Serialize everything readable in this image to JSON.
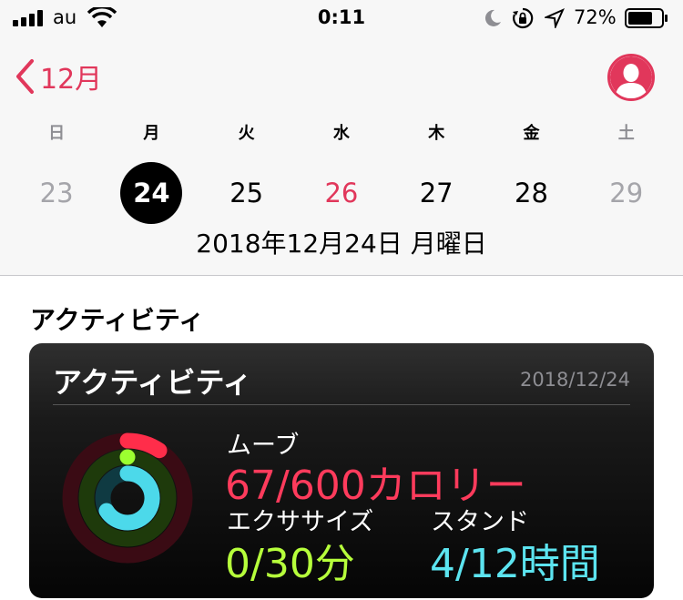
{
  "status_bar": {
    "carrier": "au",
    "time": "0:11",
    "battery_percent": "72%",
    "battery_level": 0.72
  },
  "nav": {
    "back_label": "12月"
  },
  "week": {
    "weekdays": [
      "日",
      "月",
      "火",
      "水",
      "木",
      "金",
      "土"
    ],
    "dates": [
      "23",
      "24",
      "25",
      "26",
      "27",
      "28",
      "29"
    ],
    "selected_index": 1,
    "highlighted_index": 3,
    "full_date": "2018年12月24日 月曜日"
  },
  "section": {
    "title": "アクティビティ"
  },
  "card": {
    "title": "アクティビティ",
    "date": "2018/12/24",
    "move_label": "ムーブ",
    "move_value": "67/600カロリー",
    "exercise_label": "エクササイズ",
    "exercise_value": "0/30分",
    "stand_label": "スタンド",
    "stand_value": "4/12時間"
  },
  "colors": {
    "accent": "#e1375b",
    "move": "#ff3b5c",
    "exercise": "#b6ff3b",
    "stand": "#5ce4f0"
  },
  "icons": [
    "cellular-signal-icon",
    "wifi-icon",
    "moon-icon",
    "rotation-lock-icon",
    "location-arrow-icon",
    "battery-icon",
    "chevron-left-icon",
    "person-icon"
  ]
}
